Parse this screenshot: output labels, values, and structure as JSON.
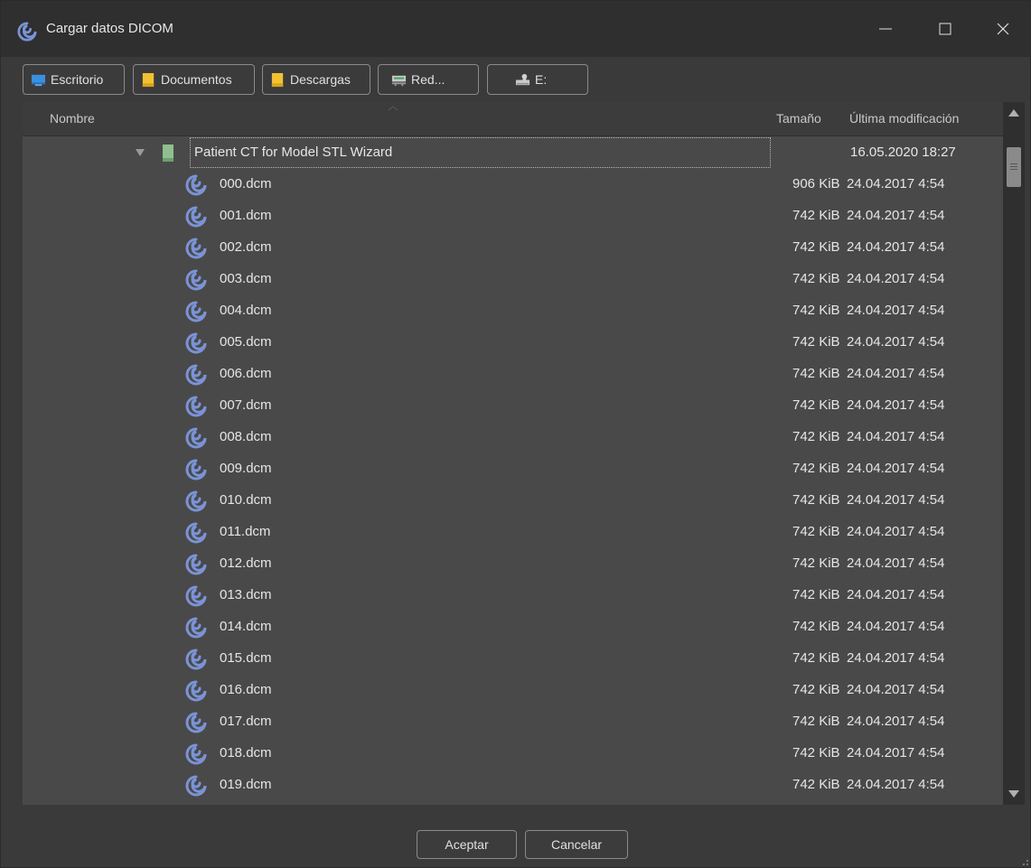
{
  "window": {
    "title": "Cargar datos DICOM"
  },
  "locations": [
    {
      "label": "Escritorio",
      "icon": "desktop-icon"
    },
    {
      "label": "Documentos",
      "icon": "folder-icon"
    },
    {
      "label": "Descargas",
      "icon": "folder-icon"
    },
    {
      "label": "Red...",
      "icon": "network-icon"
    },
    {
      "label": "E:",
      "icon": "drive-icon"
    }
  ],
  "columns": {
    "name": "Nombre",
    "size": "Tamaño",
    "modified": "Última modificación"
  },
  "folder": {
    "name": "Patient CT for Model STL Wizard",
    "modified": "16.05.2020 18:27"
  },
  "files": [
    {
      "name": "000.dcm",
      "size": "906 KiB",
      "modified": "24.04.2017 4:54"
    },
    {
      "name": "001.dcm",
      "size": "742 KiB",
      "modified": "24.04.2017 4:54"
    },
    {
      "name": "002.dcm",
      "size": "742 KiB",
      "modified": "24.04.2017 4:54"
    },
    {
      "name": "003.dcm",
      "size": "742 KiB",
      "modified": "24.04.2017 4:54"
    },
    {
      "name": "004.dcm",
      "size": "742 KiB",
      "modified": "24.04.2017 4:54"
    },
    {
      "name": "005.dcm",
      "size": "742 KiB",
      "modified": "24.04.2017 4:54"
    },
    {
      "name": "006.dcm",
      "size": "742 KiB",
      "modified": "24.04.2017 4:54"
    },
    {
      "name": "007.dcm",
      "size": "742 KiB",
      "modified": "24.04.2017 4:54"
    },
    {
      "name": "008.dcm",
      "size": "742 KiB",
      "modified": "24.04.2017 4:54"
    },
    {
      "name": "009.dcm",
      "size": "742 KiB",
      "modified": "24.04.2017 4:54"
    },
    {
      "name": "010.dcm",
      "size": "742 KiB",
      "modified": "24.04.2017 4:54"
    },
    {
      "name": "011.dcm",
      "size": "742 KiB",
      "modified": "24.04.2017 4:54"
    },
    {
      "name": "012.dcm",
      "size": "742 KiB",
      "modified": "24.04.2017 4:54"
    },
    {
      "name": "013.dcm",
      "size": "742 KiB",
      "modified": "24.04.2017 4:54"
    },
    {
      "name": "014.dcm",
      "size": "742 KiB",
      "modified": "24.04.2017 4:54"
    },
    {
      "name": "015.dcm",
      "size": "742 KiB",
      "modified": "24.04.2017 4:54"
    },
    {
      "name": "016.dcm",
      "size": "742 KiB",
      "modified": "24.04.2017 4:54"
    },
    {
      "name": "017.dcm",
      "size": "742 KiB",
      "modified": "24.04.2017 4:54"
    },
    {
      "name": "018.dcm",
      "size": "742 KiB",
      "modified": "24.04.2017 4:54"
    },
    {
      "name": "019.dcm",
      "size": "742 KiB",
      "modified": "24.04.2017 4:54"
    }
  ],
  "buttons": {
    "ok": "Aceptar",
    "cancel": "Cancelar"
  },
  "colors": {
    "dicom_icon": "#7b93d6",
    "desktop_icon": "#3a8fe0",
    "folder_icon": "#f2c232",
    "network_icon": "#3aa060"
  }
}
